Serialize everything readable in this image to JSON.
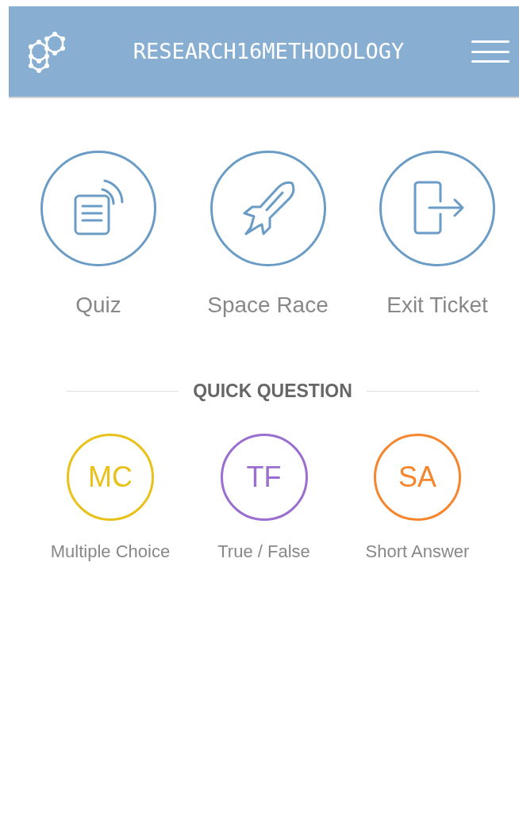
{
  "header": {
    "title": "RESEARCH16METHODOLOGY"
  },
  "activities": [
    {
      "kind": "quiz",
      "label": "Quiz"
    },
    {
      "kind": "rocket",
      "label": "Space Race"
    },
    {
      "kind": "exit",
      "label": "Exit Ticket"
    }
  ],
  "quick_question": {
    "heading": "QUICK QUESTION",
    "items": [
      {
        "abbr": "MC",
        "label": "Multiple Choice",
        "color": "#e8c21a"
      },
      {
        "abbr": "TF",
        "label": "True / False",
        "color": "#9a6fd0"
      },
      {
        "abbr": "SA",
        "label": "Short Answer",
        "color": "#f5862e"
      }
    ]
  }
}
